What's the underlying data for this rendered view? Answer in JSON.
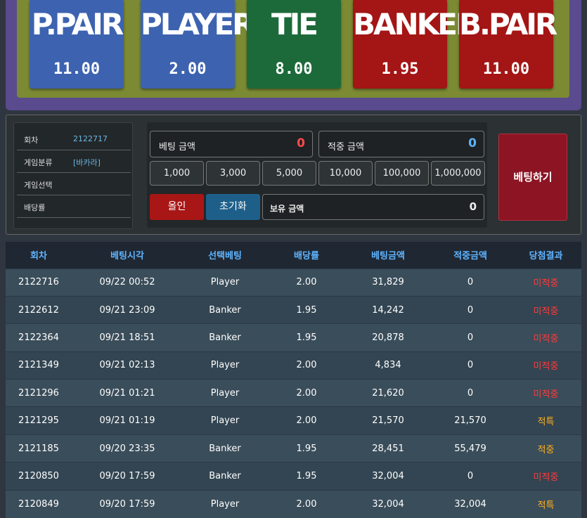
{
  "cards": [
    {
      "name": "P.PAIR",
      "odds": "11.00",
      "color": "#3d63b0"
    },
    {
      "name": "PLAYER",
      "odds": "2.00",
      "color": "#3d63b0"
    },
    {
      "name": "TIE",
      "odds": "8.00",
      "color": "#1c6a3a"
    },
    {
      "name": "BANKER",
      "odds": "1.95",
      "color": "#a41515"
    },
    {
      "name": "B.PAIR",
      "odds": "11.00",
      "color": "#a41515"
    }
  ],
  "info": {
    "round_label": "회차",
    "round_value": "2122717",
    "category_label": "게임분류",
    "category_value": "[바카라]",
    "select_label": "게임선택",
    "odds_label": "배당률"
  },
  "bet": {
    "bet_amount_label": "베팅 금액",
    "bet_amount_value": "0",
    "win_amount_label": "적중 금액",
    "win_amount_value": "0",
    "chips": [
      "1,000",
      "3,000",
      "5,000",
      "10,000",
      "100,000",
      "1,000,000"
    ],
    "allin_label": "올인",
    "reset_label": "초기화",
    "owned_label": "보유 금액",
    "owned_value": "0",
    "submit_label": "베팅하기"
  },
  "history": {
    "headers": [
      "회차",
      "베팅시각",
      "선택베팅",
      "배당률",
      "베팅금액",
      "적중금액",
      "당첨결과"
    ],
    "rows": [
      [
        "2122716",
        "09/22 00:52",
        "Player",
        "2.00",
        "31,829",
        "0",
        "미적중"
      ],
      [
        "2122612",
        "09/21 23:09",
        "Banker",
        "1.95",
        "14,242",
        "0",
        "미적중"
      ],
      [
        "2122364",
        "09/21 18:51",
        "Banker",
        "1.95",
        "20,878",
        "0",
        "미적중"
      ],
      [
        "2121349",
        "09/21 02:13",
        "Player",
        "2.00",
        "4,834",
        "0",
        "미적중"
      ],
      [
        "2121296",
        "09/21 01:21",
        "Player",
        "2.00",
        "21,620",
        "0",
        "미적중"
      ],
      [
        "2121295",
        "09/21 01:19",
        "Player",
        "2.00",
        "21,570",
        "21,570",
        "적특"
      ],
      [
        "2121185",
        "09/20 23:35",
        "Banker",
        "1.95",
        "28,451",
        "55,479",
        "적중"
      ],
      [
        "2120850",
        "09/20 17:59",
        "Banker",
        "1.95",
        "32,004",
        "0",
        "미적중"
      ],
      [
        "2120849",
        "09/20 17:59",
        "Player",
        "2.00",
        "32,004",
        "32,004",
        "적특"
      ]
    ]
  }
}
